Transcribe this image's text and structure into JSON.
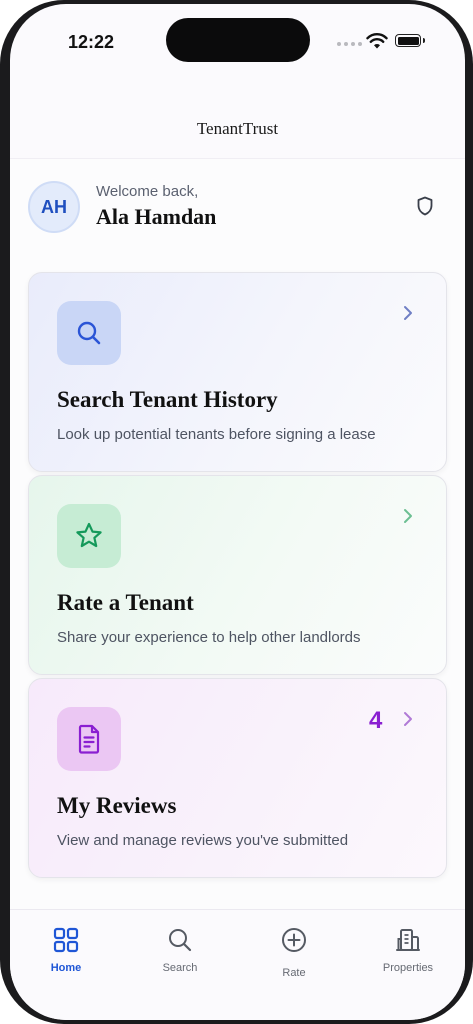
{
  "status_bar": {
    "time": "12:22"
  },
  "header": {
    "title": "TenantTrust"
  },
  "welcome": {
    "greeting": "Welcome back,",
    "name": "Ala Hamdan",
    "initials": "AH"
  },
  "cards": [
    {
      "title": "Search Tenant History",
      "description": "Look up potential tenants before signing a lease",
      "icon": "search-icon",
      "accent": "#2b55d6"
    },
    {
      "title": "Rate a Tenant",
      "description": "Share your experience to help other landlords",
      "icon": "star-icon",
      "accent": "#14995a"
    },
    {
      "title": "My Reviews",
      "description": "View and manage reviews you've submitted",
      "icon": "document-icon",
      "accent": "#8a1fd1",
      "count": "4"
    }
  ],
  "tabs": [
    {
      "label": "Home",
      "icon": "grid-icon",
      "active": true
    },
    {
      "label": "Search",
      "icon": "search-icon"
    },
    {
      "label": "Rate",
      "icon": "plus-circle-icon"
    },
    {
      "label": "Properties",
      "icon": "building-icon"
    }
  ],
  "colors": {
    "primary": "#1f56d6",
    "accent_purple": "#8a1fd1",
    "text": "#111111",
    "muted": "#4e5462"
  }
}
